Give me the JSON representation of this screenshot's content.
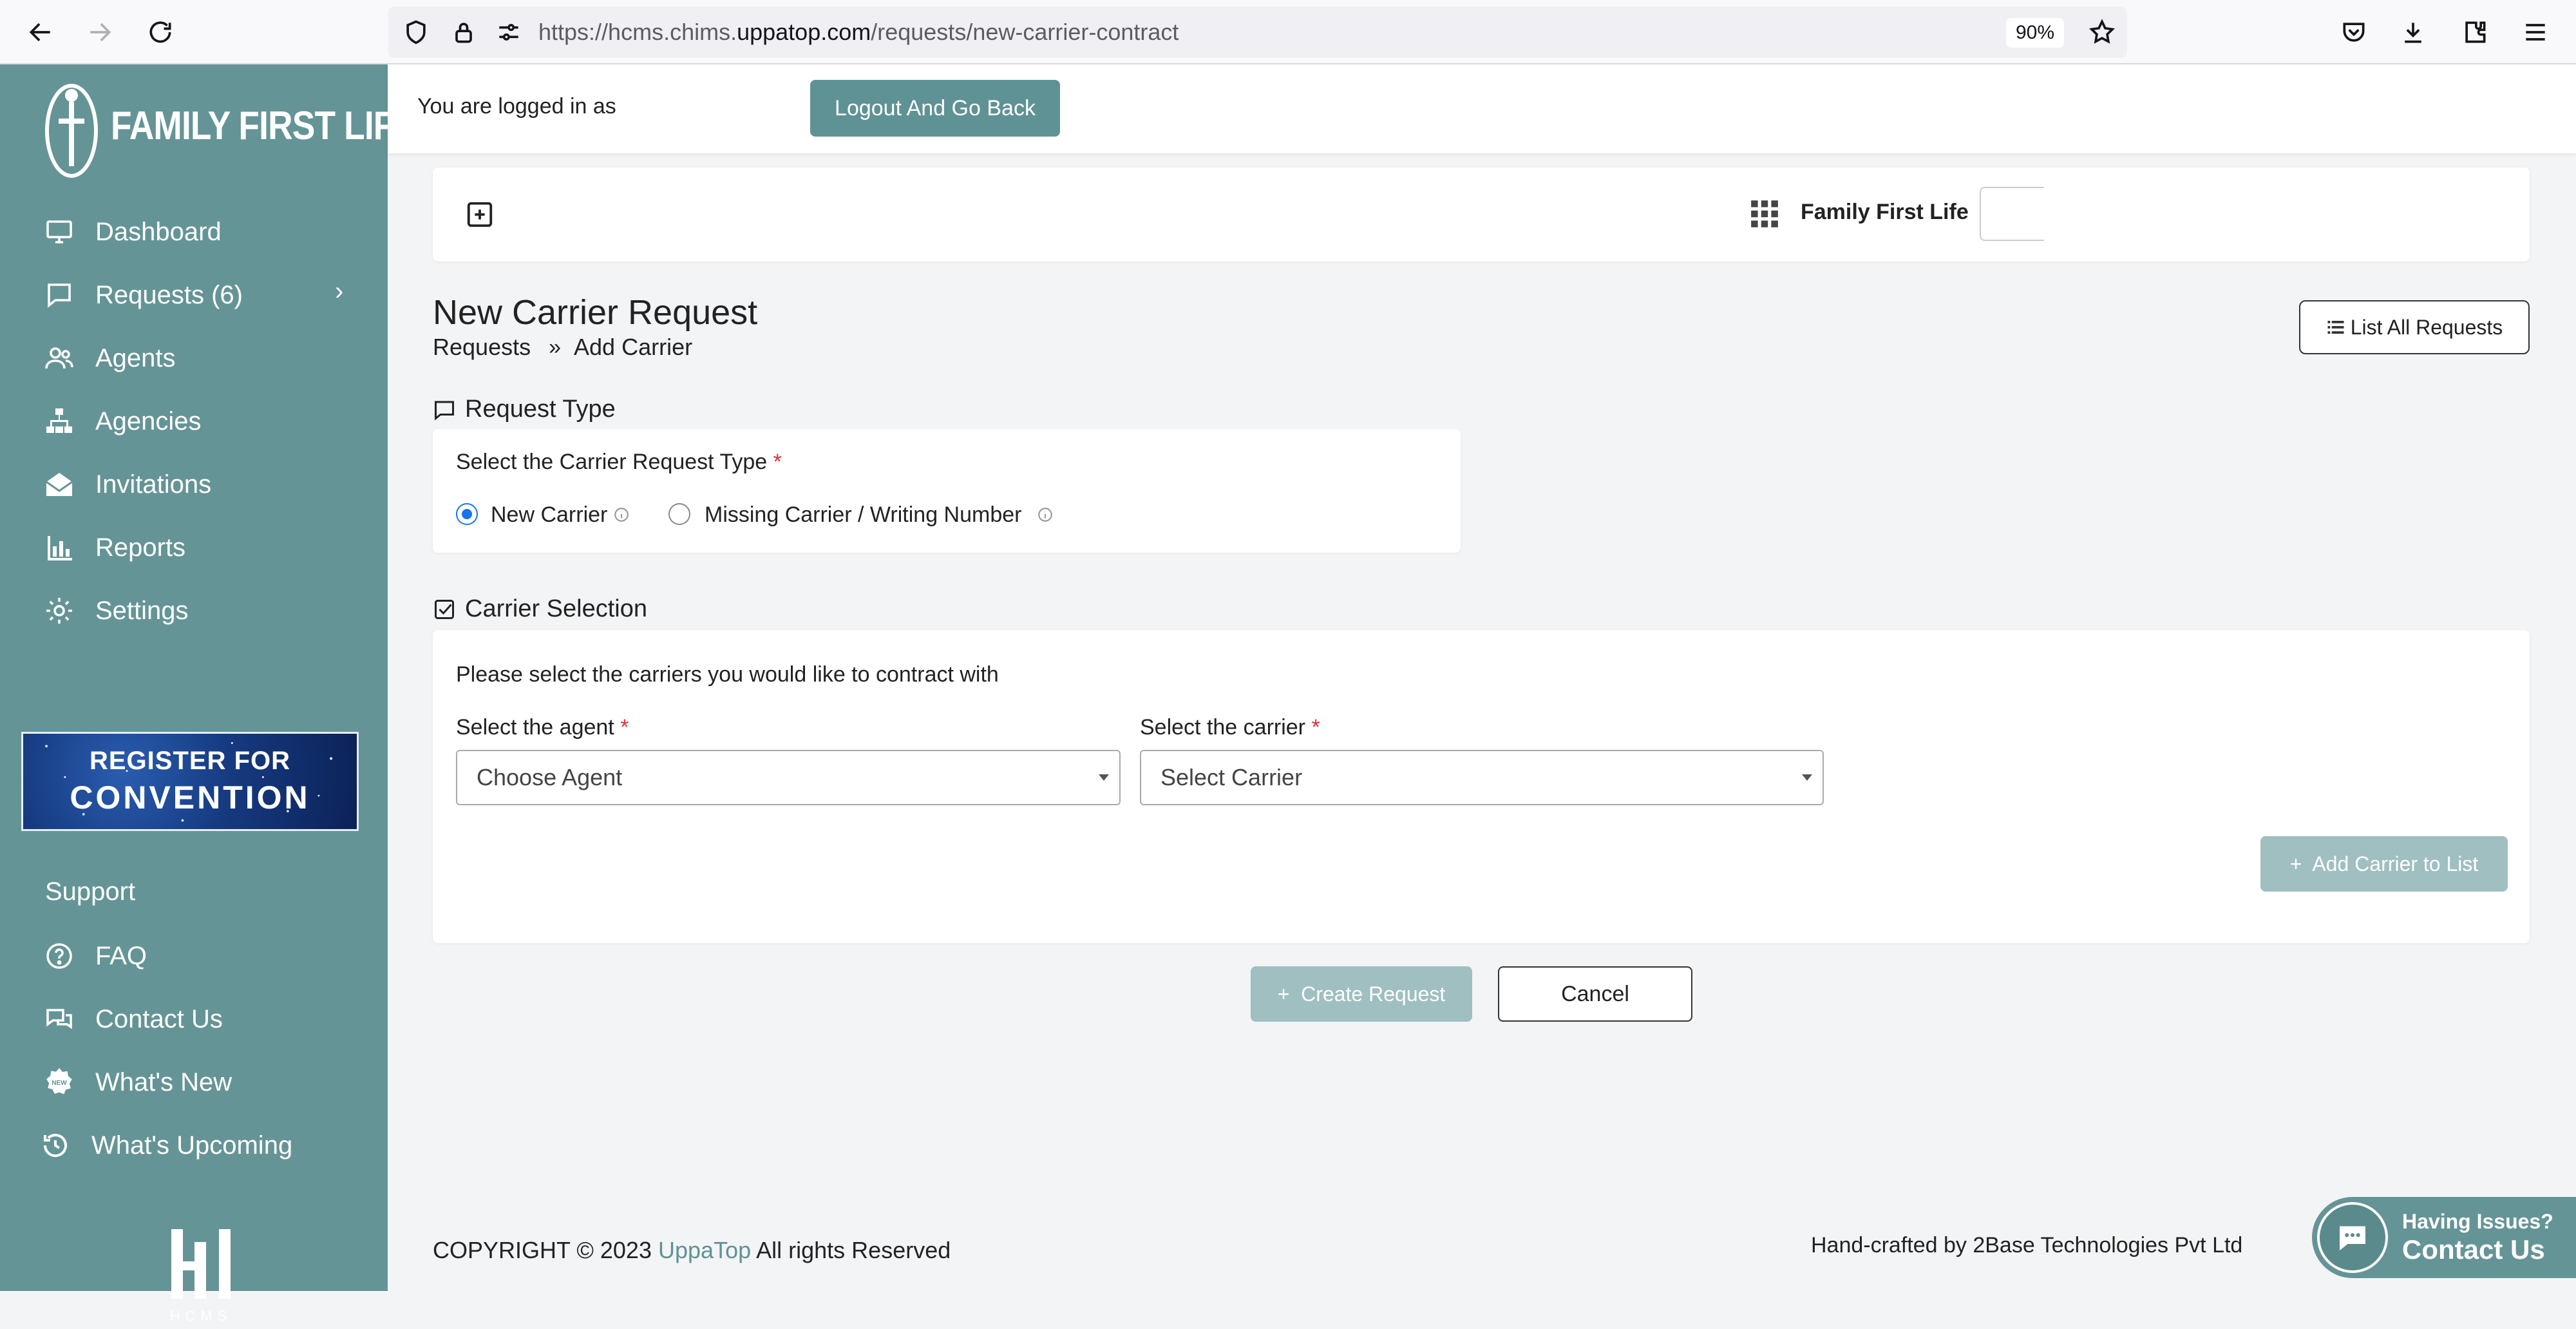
{
  "browser": {
    "url_prefix": "https://hcms.chims.",
    "url_domain": "uppatop.com",
    "url_path": "/requests/new-carrier-contract",
    "zoom": "90%"
  },
  "sidebar": {
    "brand": "FAMILY FIRST LIFE",
    "items": [
      {
        "label": "Dashboard",
        "icon": "monitor-icon"
      },
      {
        "label": "Requests (6)",
        "icon": "chat-icon"
      },
      {
        "label": "Agents",
        "icon": "users-icon"
      },
      {
        "label": "Agencies",
        "icon": "sitemap-icon"
      },
      {
        "label": "Invitations",
        "icon": "envelope-open-icon"
      },
      {
        "label": "Reports",
        "icon": "bar-chart-icon"
      },
      {
        "label": "Settings",
        "icon": "gear-icon"
      }
    ],
    "banner": {
      "line1": "REGISTER FOR",
      "line2": "CONVENTION"
    },
    "support_heading": "Support",
    "support_items": [
      {
        "label": "FAQ",
        "icon": "question-circle-icon"
      },
      {
        "label": "Contact Us",
        "icon": "chat-bubbles-icon"
      },
      {
        "label": "What's New",
        "icon": "new-badge-icon"
      },
      {
        "label": "What's Upcoming",
        "icon": "history-icon"
      }
    ],
    "footer_logo": "HCMS"
  },
  "header": {
    "logged_in_text": "You are logged in as",
    "logout_label": "Logout And Go Back"
  },
  "toolbar": {
    "org_name": "Family First Life"
  },
  "page": {
    "title": "New Carrier Request",
    "breadcrumb": [
      "Requests",
      "Add Carrier"
    ],
    "list_all_label": "List All Requests"
  },
  "request_type": {
    "heading": "Request Type",
    "label": "Select the Carrier Request Type",
    "options": [
      "New Carrier",
      "Missing Carrier / Writing Number"
    ],
    "selected": "New Carrier"
  },
  "carrier_selection": {
    "heading": "Carrier Selection",
    "instructions": "Please select the carriers you would like to contract with",
    "agent_label": "Select the agent",
    "agent_placeholder": "Choose Agent",
    "carrier_label": "Select the carrier",
    "carrier_placeholder": "Select Carrier",
    "add_button": "Add Carrier to List"
  },
  "actions": {
    "create_label": "Create Request",
    "cancel_label": "Cancel"
  },
  "footer": {
    "copyright_prefix": "COPYRIGHT © 2023",
    "company_link": "UppaTop",
    "copyright_suffix": "All rights Reserved",
    "credit": "Hand-crafted by 2Base Technologies Pvt Ltd"
  },
  "help_widget": {
    "line1": "Having Issues?",
    "line2": "Contact Us"
  },
  "colors": {
    "sidebar": "#659496",
    "primary_button": "#5f9294",
    "disabled_button": "#9fbfc1",
    "radio_selected": "#1a73e8",
    "required": "#e0303a"
  }
}
